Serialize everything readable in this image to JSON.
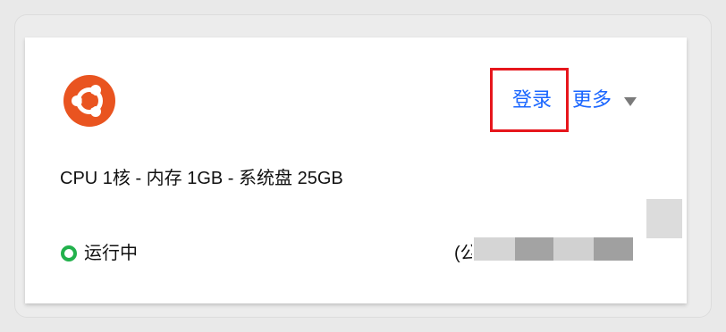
{
  "card": {
    "os": {
      "icon": "ubuntu-icon",
      "brand_color": "#e95420"
    },
    "actions": {
      "login_label": "登录",
      "more_label": "更多",
      "more_icon": "chevron-down-icon"
    },
    "specs": "CPU 1核 - 内存 1GB - 系统盘 25GB",
    "status": {
      "label": "运行中",
      "color": "#22b14c"
    },
    "ip": {
      "visible_prefix": "(公"
    },
    "redaction_colors": [
      "#d5d5d5",
      "#a3a3a3",
      "#d1d1d1",
      "#a0a0a0",
      "#d7d7d7"
    ]
  }
}
